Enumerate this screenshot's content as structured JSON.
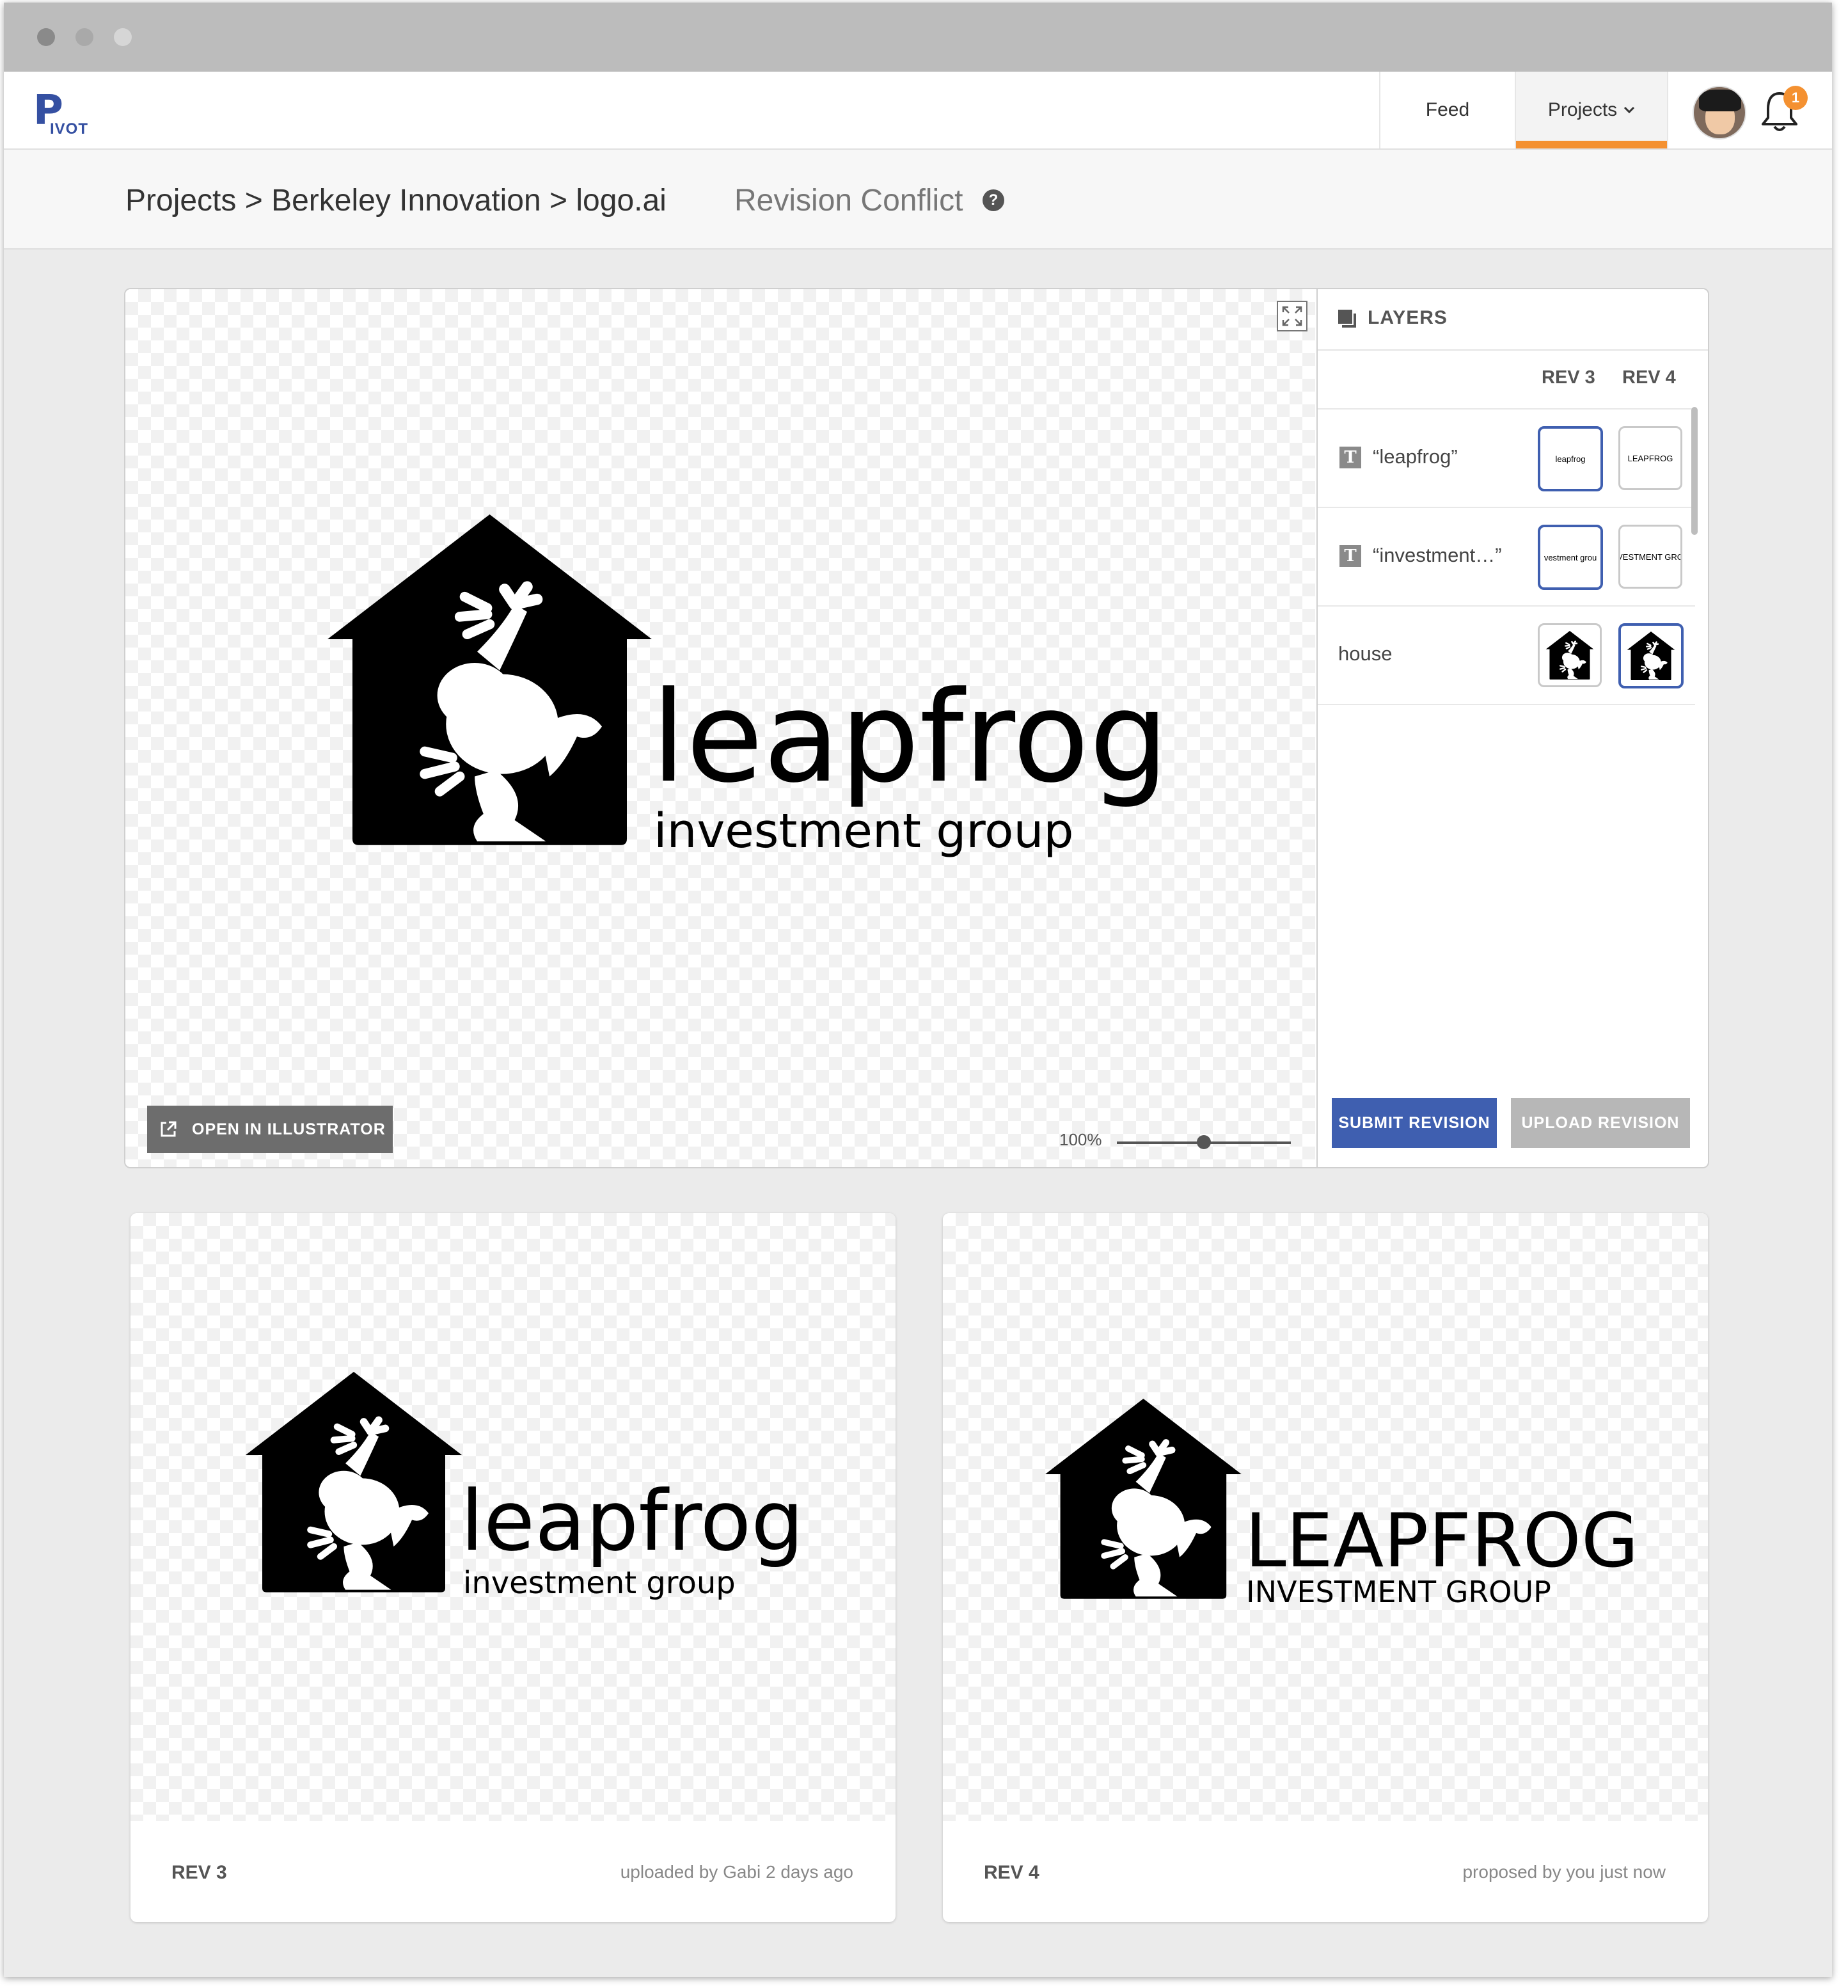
{
  "app": {
    "logo_letter": "P",
    "logo_word": "IVOT"
  },
  "nav": {
    "feed": "Feed",
    "projects": "Projects",
    "notification_count": "1",
    "accent": "#f49131"
  },
  "breadcrumb": {
    "path": "Projects > Berkeley Innovation > logo.ai",
    "status": "Revision Conflict",
    "help": "?"
  },
  "editor": {
    "open_label": "OPEN IN ILLUSTRATOR",
    "zoom_label": "100%",
    "zoom_level": 0.5,
    "artwork": {
      "name": "leapfrog",
      "tagline": "investment group"
    }
  },
  "layers": {
    "title": "LAYERS",
    "rev_a": "REV 3",
    "rev_b": "REV 4",
    "items": [
      {
        "name": "“leapfrog”",
        "type": "text",
        "thumb_a": "leapfrog",
        "thumb_b": "LEAPFROG",
        "selected": "rev_a"
      },
      {
        "name": "“investment…”",
        "type": "text",
        "thumb_a": "vestment grou",
        "thumb_b": "VESTMENT GRO",
        "selected": "rev_a"
      },
      {
        "name": "house",
        "type": "shape",
        "selected": "rev_b"
      }
    ],
    "submit": "SUBMIT REVISION",
    "upload": "UPLOAD REVISION",
    "primary_color": "#3f5fb0"
  },
  "revisions": [
    {
      "label": "REV 3",
      "meta": "uploaded by Gabi 2 days ago",
      "name": "leapfrog",
      "tagline": "investment group"
    },
    {
      "label": "REV 4",
      "meta": "proposed by you just now",
      "name": "LEAPFROG",
      "tagline": "INVESTMENT GROUP"
    }
  ],
  "icons": [
    "expand-icon",
    "external-link-icon",
    "layers-icon",
    "bell-icon",
    "chevron-down-icon",
    "help-icon",
    "text-layer-icon",
    "house-frog-icon"
  ]
}
